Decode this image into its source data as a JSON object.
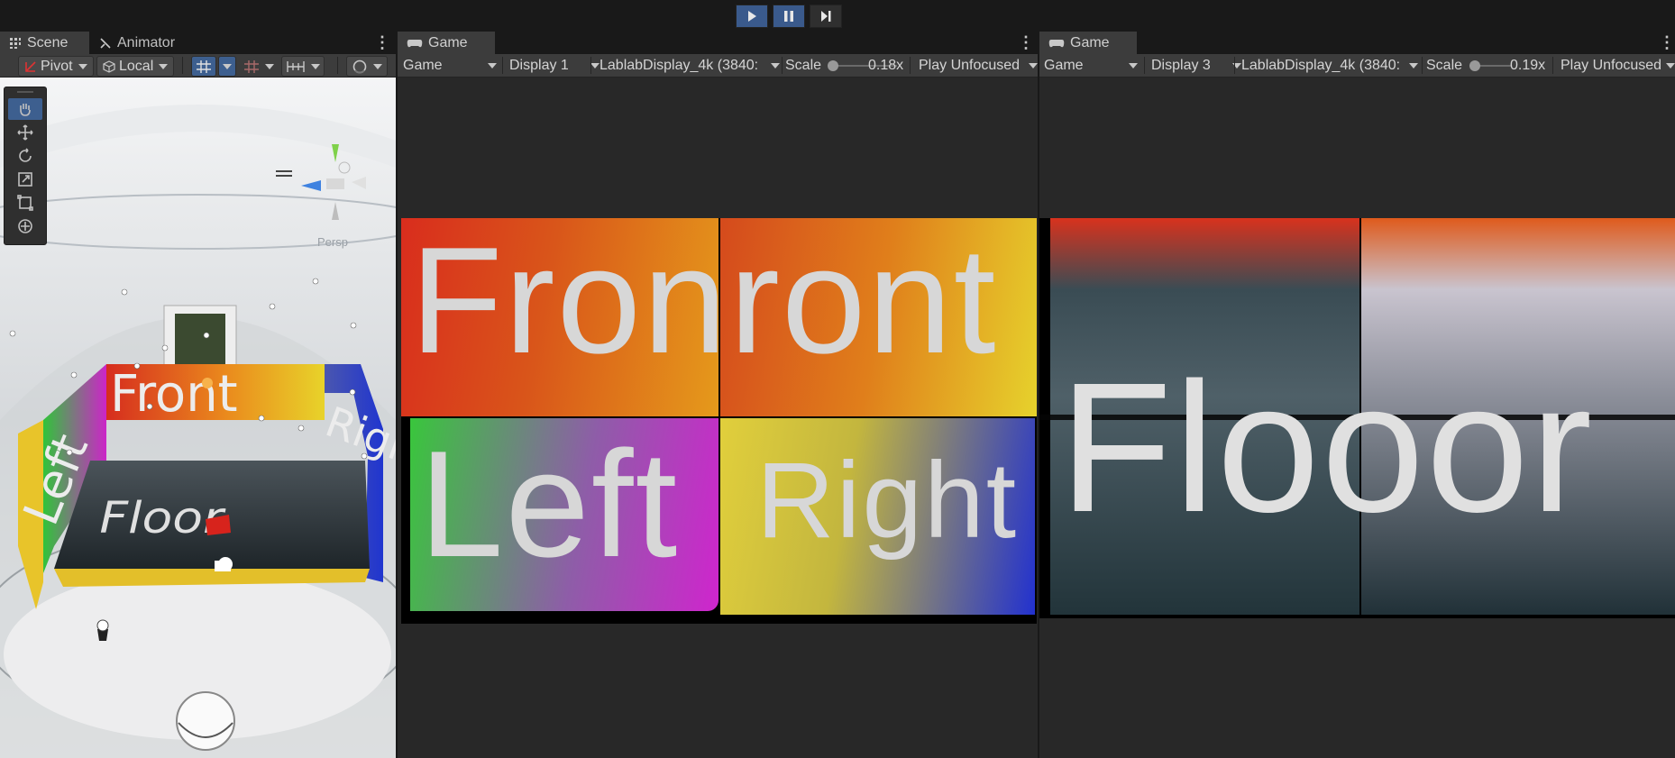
{
  "play_controls": {
    "play": "play-icon",
    "pause": "pause-icon",
    "step": "step-icon"
  },
  "scene_pane": {
    "tabs": [
      {
        "label": "Scene",
        "icon": "grid-icon"
      },
      {
        "label": "Animator",
        "icon": "animator-icon"
      }
    ],
    "toolbar": {
      "pivot": "Pivot",
      "local": "Local"
    },
    "tools": [
      "hand-icon",
      "move-icon",
      "rotate-icon",
      "scale-icon",
      "rect-icon",
      "transform-icon"
    ],
    "gizmo_label": "Persp",
    "scene_labels": {
      "front": "Front",
      "left": "Left",
      "right": "Right",
      "floor": "Floor"
    }
  },
  "game_pane_1": {
    "tab_label": "Game",
    "mode": "Game",
    "display": "Display 1",
    "resolution": "LablabDisplay_4k (3840:",
    "scale_label": "Scale",
    "scale_value": "0.18x",
    "scale_fraction": 0.18,
    "play_mode": "Play Unfocused",
    "tiles": {
      "top_left": "Fron",
      "top_right": "ront",
      "bottom_left": "Left",
      "bottom_right": "Right"
    }
  },
  "game_pane_2": {
    "tab_label": "Game",
    "mode": "Game",
    "display": "Display 3",
    "resolution": "LablabDisplay_4k (3840:",
    "scale_label": "Scale",
    "scale_value": "0.19x",
    "scale_fraction": 0.19,
    "play_mode": "Play Unfocused",
    "floor_text": "Flooor"
  },
  "colors": {
    "play_active": "#3a5a8c",
    "panel_bg": "#282828",
    "tab_active": "#3c3c3c",
    "front_red": "#d33a1a",
    "front_yellow": "#e6c52e",
    "left_green": "#3fbf2f",
    "left_magenta": "#c81fd0",
    "right_blue": "#1c2fd0",
    "floor_dark": "#25383f"
  }
}
